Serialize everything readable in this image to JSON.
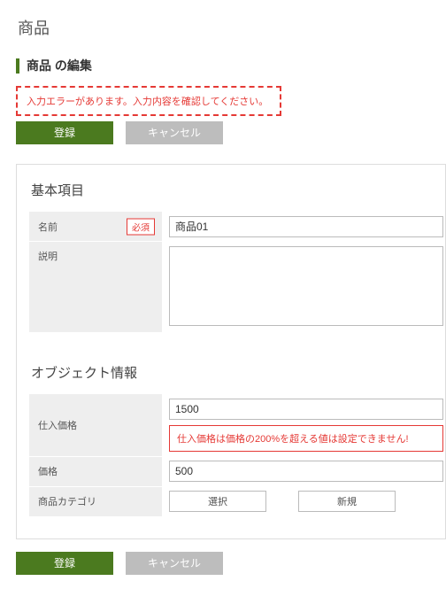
{
  "page": {
    "title": "商品"
  },
  "subtitle": "商品 の編集",
  "error_banner": "入力エラーがあります。入力内容を確認してください。",
  "buttons": {
    "register": "登録",
    "cancel": "キャンセル",
    "select": "選択",
    "new": "新規"
  },
  "sections": {
    "basic": {
      "title": "基本項目"
    },
    "object": {
      "title": "オブジェクト情報"
    }
  },
  "fields": {
    "name": {
      "label": "名前",
      "required_badge": "必須",
      "value": "商品01"
    },
    "description": {
      "label": "説明",
      "value": ""
    },
    "purchase_price": {
      "label": "仕入価格",
      "value": "1500",
      "error": "仕入価格は価格の200%を超える値は設定できません!"
    },
    "price": {
      "label": "価格",
      "value": "500"
    },
    "category": {
      "label": "商品カテゴリ"
    }
  }
}
